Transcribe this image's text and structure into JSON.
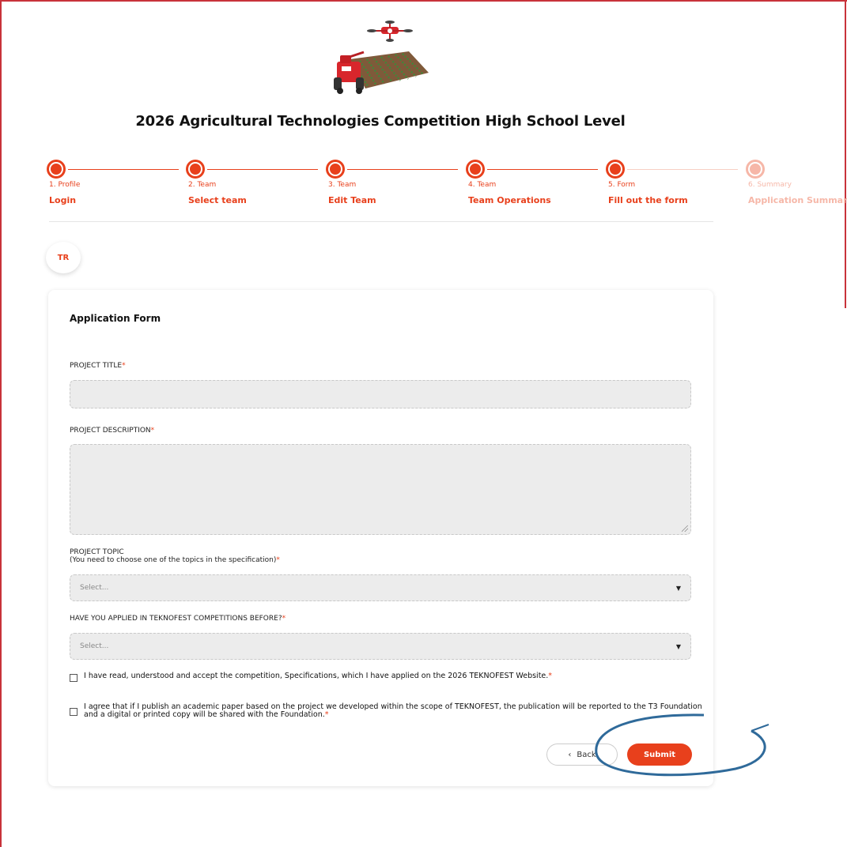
{
  "header": {
    "title": "2026 Agricultural Technologies Competition High School Level"
  },
  "steps": [
    {
      "number": "1. Profile",
      "name": "Login",
      "state": "done"
    },
    {
      "number": "2. Team",
      "name": "Select team",
      "state": "done"
    },
    {
      "number": "3. Team",
      "name": "Edit Team",
      "state": "done"
    },
    {
      "number": "4. Team",
      "name": "Team Operations",
      "state": "done"
    },
    {
      "number": "5. Form",
      "name": "Fill out the form",
      "state": "current"
    },
    {
      "number": "6. Summary",
      "name": "Application Summary",
      "state": "pending"
    }
  ],
  "language": {
    "code": "TR"
  },
  "form": {
    "title": "Application Form",
    "project_title": {
      "label": "PROJECT TITLE",
      "required_mark": "*",
      "value": ""
    },
    "project_description": {
      "label": "PROJECT DESCRIPTION",
      "required_mark": "*",
      "value": ""
    },
    "project_topic": {
      "label_line1": "PROJECT TOPIC",
      "label_line2": "(You need to choose one of the topics in the specification)",
      "required_mark": "*",
      "placeholder": "Select..."
    },
    "applied_before": {
      "label": "HAVE YOU APPLIED IN TEKNOFEST COMPETITIONS BEFORE?",
      "required_mark": "*",
      "placeholder": "Select..."
    },
    "agreement_1": {
      "text": "I have read, understood and accept the competition, Specifications, which I have applied on the 2026 TEKNOFEST Website.",
      "required_mark": "*",
      "checked": false
    },
    "agreement_2": {
      "text": "I agree that if I publish an academic paper based on the project we developed within the scope of TEKNOFEST, the publication will be reported to the T3 Foundation and a digital or printed copy will be shared with the Foundation.",
      "required_mark": "*",
      "checked": false
    },
    "back_label": "Back",
    "submit_label": "Submit"
  },
  "colors": {
    "accent": "#e8401c",
    "accent_light": "#f6b7a8",
    "frame": "#c8323a",
    "annotation": "#2f6a9a",
    "field_bg": "#ececec"
  },
  "icons": {
    "logo": "agricultural-robot-drone-icon",
    "back": "chevron-left-icon",
    "select": "caret-down-icon"
  }
}
